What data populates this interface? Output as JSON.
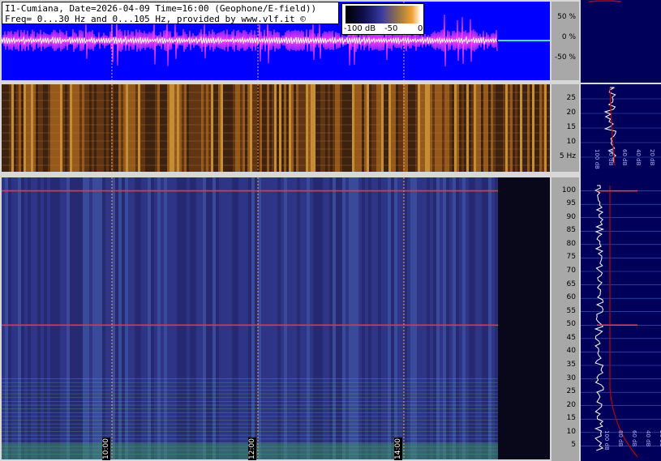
{
  "header": {
    "line1": "I1-Cumiana, Date=2026-04-09 Time=16:00 (Geophone/E-field))",
    "line2": "Freq= 0...30 Hz and 0...105 Hz, provided by www.vlf.it ©"
  },
  "colorbar": {
    "labels": [
      "-100 dB",
      "-50",
      "0"
    ]
  },
  "chart_data": [
    {
      "type": "line",
      "panel": "waveform",
      "yticks": [
        "50 %",
        "0 %",
        "-50 %"
      ],
      "colors": {
        "background": "#0000ff",
        "trace": "#ff40ff",
        "trace_core": "#ffffff"
      }
    },
    {
      "type": "heatmap",
      "panel": "spectrogram-low",
      "ylim": [
        0,
        30
      ],
      "yticks": [
        "25",
        "20",
        "15",
        "10",
        "5 Hz"
      ],
      "profile_xticks": [
        "100 dB",
        "80 dB",
        "60 dB",
        "40 dB",
        "20 dB"
      ]
    },
    {
      "type": "heatmap",
      "panel": "spectrogram-high",
      "ylim": [
        0,
        105
      ],
      "yticks": [
        "100",
        "95",
        "90",
        "85",
        "80",
        "75",
        "70",
        "65",
        "60",
        "55",
        "50",
        "45",
        "40",
        "35",
        "30",
        "25",
        "20",
        "15",
        "10",
        "5"
      ],
      "xticks": [
        "10:00",
        "12:00",
        "14:00"
      ],
      "profile_xticks": [
        "100 dB",
        "80 dB",
        "60 dB",
        "40 dB",
        "20 dB"
      ],
      "lines_hz": [
        100,
        50
      ]
    }
  ]
}
